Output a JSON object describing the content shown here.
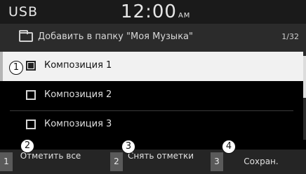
{
  "status_bar": {
    "source": "USB",
    "time": "12:00",
    "ampm": "AM"
  },
  "path_bar": {
    "text": "Добавить в папку \"Моя Музыка\"",
    "page_indicator": "1/32"
  },
  "list": {
    "items": [
      {
        "label": "Композиция 1",
        "checked": true,
        "selected": true
      },
      {
        "label": "Композиция 2",
        "checked": false,
        "selected": false
      },
      {
        "label": "Композиция 3",
        "checked": false,
        "selected": false
      }
    ]
  },
  "softkeys": [
    {
      "number": "1",
      "label": "Отметить все"
    },
    {
      "number": "2",
      "label": "Снять отметки"
    },
    {
      "number": "3",
      "label": "Сохран."
    }
  ],
  "callouts": [
    "1",
    "2",
    "3",
    "4"
  ]
}
